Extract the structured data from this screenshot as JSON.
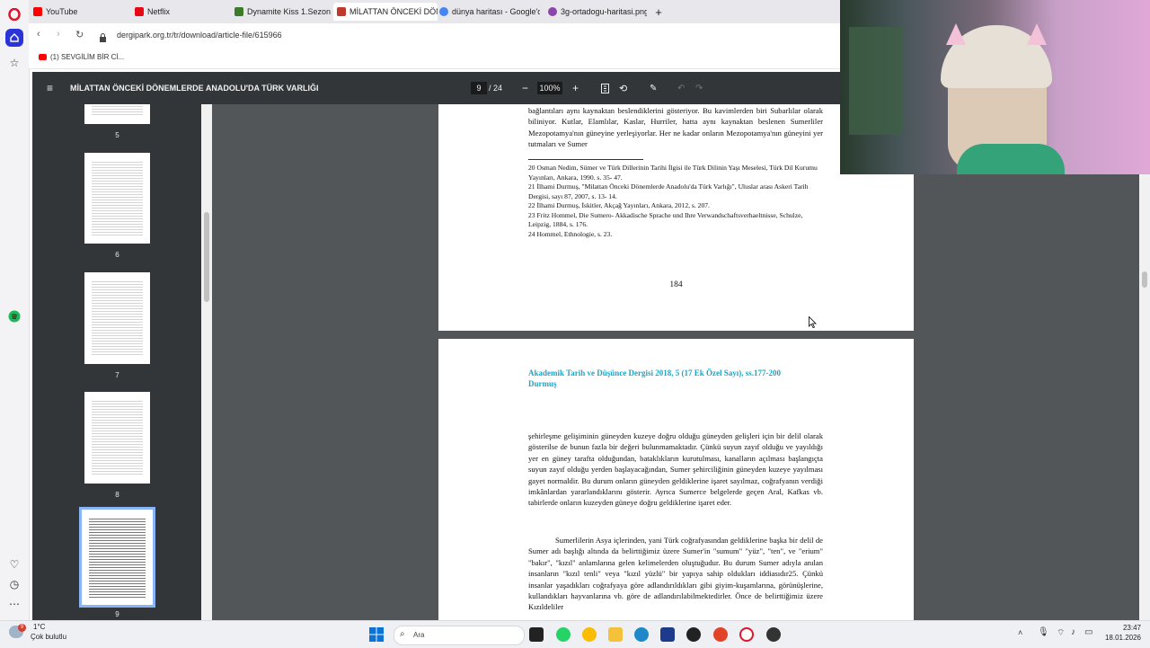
{
  "browser": {
    "tabs": [
      {
        "label": "YouTube",
        "color": "#ff0000"
      },
      {
        "label": "Netflix",
        "color": "#e50914"
      },
      {
        "label": "Dynamite Kiss 1.Sezon 14",
        "color": "#3d7a2a"
      },
      {
        "label": "MİLATTAN ÖNCEKİ DÖNE",
        "color": "#c0392b"
      },
      {
        "label": "dünya haritası - Google'd",
        "color": "#4285f4"
      },
      {
        "label": "3g-ortadogu-haritasi.png",
        "color": "#8e44ad"
      }
    ],
    "new_tab": "+",
    "url": "dergipark.org.tr/tr/download/article-file/615966",
    "bookmark": "(1) SEVGİLİM BİR Cİ..."
  },
  "pdf": {
    "title": "MİLATTAN ÖNCEKİ DÖNEMLERDE ANADOLU'DA TÜRK VARLIĞI",
    "page_current": "9",
    "page_total": "/ 24",
    "zoom": "100%",
    "thumbnails": [
      "5",
      "6",
      "7",
      "8",
      "9"
    ],
    "page1": {
      "paragraph": "bağlantıları aynı kaynaktan beslendiklerini gösteriyor. Bu kavimlerden biri Subarlılar olarak biliniyor. Kutlar, Elamlılar, Kaslar, Hurriler, hatta aynı kaynaktan beslenen Sumerliler Mezopotamya'nın güneyine yerleşiyorlar. Her ne kadar onların Mezopotamya'nın güneyini yer tutmaları ve Sumer",
      "footnotes": [
        "20 Osman Nedim, Sümer ve Türk Dillerinin Tarihi İlgisi ile Türk Dilinin Yaşı Meselesi, Türk Dil Kurumu Yayınları, Ankara, 1990. s. 35- 47.",
        "21 İlhami Durmuş, \"Milattan Önceki Dönemlerde Anadolu'da Türk Varlığı\", Uluslar arası Askeri Tarih Dergisi, sayı 87, 2007, s. 13- 14.",
        "22 İlhami Durmuş, İskitler, Akçağ Yayınları, Ankara, 2012, s. 207.",
        "23 Fritz Hommel, Die Sumero- Akkadische Sprache und Ihre Verwandschaftsverhaeltnisse, Schulze, Leipzig, 1884, s. 176.",
        "24 Hommel, Ethnologie, s. 23."
      ],
      "page_number": "184"
    },
    "page2": {
      "header": "Akademik Tarih ve Düşünce Dergisi 2018, 5 (17 Ek Özel Sayı), ss.177-200",
      "author": "Durmuş",
      "paragraph1": "şehirleşme gelişiminin güneyden kuzeye doğru olduğu güneyden gelişleri için bir delil olarak gösterilse de bunun fazla bir değeri bulunmamaktadır. Çünkü suyun zayıf olduğu ve yayıldığı yer en güney tarafta olduğundan, bataklıkların kurutulması, kanalların açılması başlangıçta suyun zayıf olduğu yerden başlayacağından, Sumer şehirciliğinin güneyden kuzeye yayılması gayet normaldir. Bu durum onların güneyden geldiklerine işaret sayılmaz, coğrafyanın verdiği imkânlardan yararlandıklarını gösterir. Ayrıca Sumerce belgelerde geçen Aral, Kafkas vb. tabirlerde onların kuzeyden güneye doğru geldiklerine işaret eder.",
      "paragraph2": "Sumerlilerin Asya içlerinden, yani Türk coğrafyasından geldiklerine başka bir delil de Sumer adı başlığı altında da belirttiğimiz üzere Sumer'in \"sumum\" \"yüz\", \"ten\", ve \"erium\" \"bakır\", \"kızıl\" anlamlarına gelen kelimelerden oluştuğudur. Bu durum Sumer adıyla anılan insanların \"kızıl tenli\" veya \"kızıl yüzlü\" bir yapıya sahip oldukları iddiasıdır25. Çünkü insanlar yaşadıkları coğrafyaya göre adlandırıldıkları gibi giyim-kuşamlarına, görünüşlerine, kullandıkları hayvanlarına vb. göre de adlandırılabilmektedirler. Önce de belirttiğimiz üzere Kızıldeliler"
    }
  },
  "taskbar": {
    "weather_temp": "1°C",
    "weather_desc": "Çok bulutlu",
    "search_placeholder": "Ara",
    "time": "23:47",
    "date": "18.01.2026",
    "badge": "9"
  },
  "colors": {
    "toolbar": "#323639",
    "viewer_bg": "#525659",
    "journal_header": "#1aa6c8",
    "thumb_selected": "#8ab4f8"
  }
}
